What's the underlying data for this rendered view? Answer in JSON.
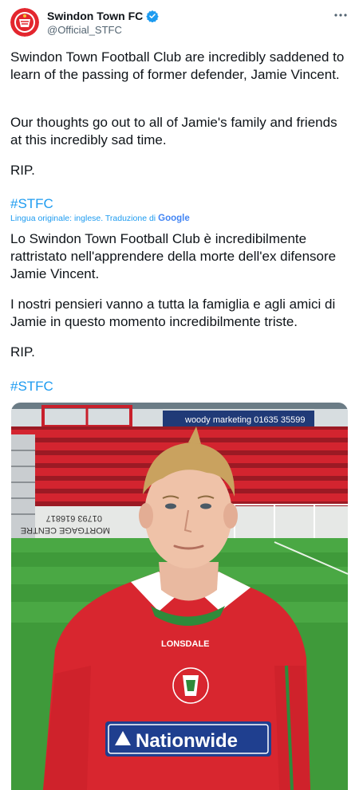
{
  "account": {
    "name": "Swindon Town FC",
    "handle": "@Official_STFC",
    "verified": true,
    "avatar_icon": "swindon-town-crest-icon"
  },
  "more_icon": "more-dots-icon",
  "tweet": {
    "paragraph1": "Swindon Town Football Club are incredibly saddened to learn of the passing of former defender, Jamie Vincent.",
    "paragraph2": "Our thoughts go out to all of Jamie's family and friends at this incredibly sad time.",
    "paragraph3": "RIP.",
    "hashtag": "#STFC"
  },
  "translation": {
    "note": "Lingua originale: inglese. Traduzione di",
    "provider": "Google",
    "paragraph1": "Lo Swindon Town Football Club è incredibilmente rattristato nell'apprendere della morte dell'ex difensore Jamie Vincent.",
    "paragraph2": " I nostri pensieri vanno a tutta la famiglia e agli amici di Jamie in questo momento incredibilmente triste.",
    "paragraph3": " RIP.",
    "hashtag": " #STFC"
  },
  "photo": {
    "sign_text": "woody marketing 01635 35599",
    "banner_text": "01793 616817",
    "banner_text2": "MORTGAGE CENTRE",
    "shirt_brand": "LONSDALE",
    "shirt_sponsor": "Nationwide"
  },
  "colors": {
    "accent": "#1d9bf0",
    "shirt": "#d8262f",
    "pitch": "#3f9a3a",
    "seats": "#c8202c"
  }
}
